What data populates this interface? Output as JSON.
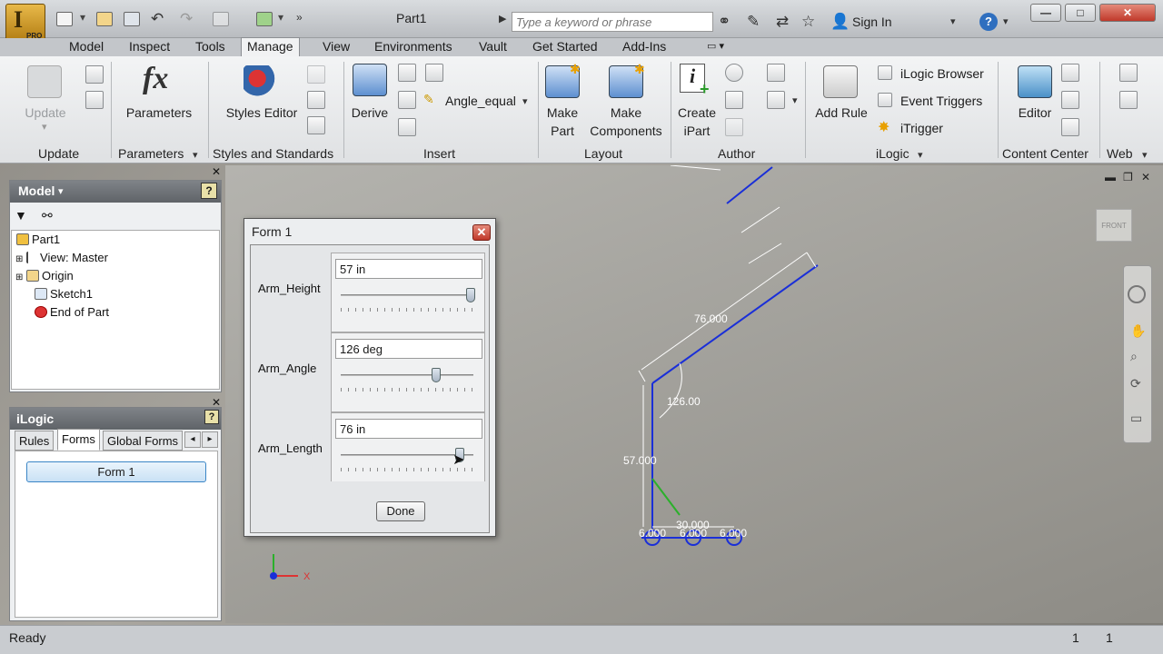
{
  "app": {
    "document_title": "Part1",
    "logo_sub": "PRO"
  },
  "search": {
    "placeholder": "Type a keyword or phrase"
  },
  "signin": {
    "label": "Sign In"
  },
  "help": {
    "label": "?"
  },
  "window": {
    "minimize": "—",
    "restore": "□",
    "close": "✕"
  },
  "ribbon_tabs": [
    "Model",
    "Inspect",
    "Tools",
    "Manage",
    "View",
    "Environments",
    "Vault",
    "Get Started",
    "Add-Ins"
  ],
  "active_tab": "Manage",
  "ribbon": {
    "update": {
      "label": "Update",
      "panel": "Update"
    },
    "parameters": {
      "label": "Parameters",
      "panel": "Parameters"
    },
    "styles_editor": {
      "label": "Styles Editor",
      "panel": "Styles and Standards"
    },
    "derive": {
      "label": "Derive"
    },
    "angle_dropdown": {
      "value": "Angle_equal"
    },
    "insert_panel": "Insert",
    "make_part": {
      "line1": "Make",
      "line2": "Part"
    },
    "make_components": {
      "line1": "Make",
      "line2": "Components"
    },
    "layout_panel": "Layout",
    "create_ipart": {
      "line1": "Create",
      "line2": "iPart"
    },
    "author_panel": "Author",
    "add_rule": {
      "label": "Add Rule"
    },
    "ilogic_browser": {
      "label": "iLogic Browser"
    },
    "event_triggers": {
      "label": "Event Triggers"
    },
    "itrigger": {
      "label": "iTrigger"
    },
    "ilogic_panel": "iLogic",
    "editor": {
      "label": "Editor"
    },
    "content_center_panel": "Content Center",
    "web_panel": "Web"
  },
  "model_browser": {
    "title": "Model",
    "items": [
      "Part1",
      "View: Master",
      "Origin",
      "Sketch1",
      "End of Part"
    ]
  },
  "ilogic_pane": {
    "title": "iLogic",
    "tabs": [
      "Rules",
      "Forms",
      "Global Forms"
    ],
    "active_tab": "Forms",
    "form_button": "Form 1"
  },
  "form1": {
    "title": "Form 1",
    "params": [
      {
        "name": "Arm_Height",
        "value": "57 in",
        "slider_fraction": 0.98
      },
      {
        "name": "Arm_Angle",
        "value": "126 deg",
        "slider_fraction": 0.72
      },
      {
        "name": "Arm_Length",
        "value": "76 in",
        "slider_fraction": 0.9
      }
    ],
    "done": "Done"
  },
  "sketch": {
    "dim_length": "76.000",
    "dim_angle": "126.00",
    "dim_height": "57.000",
    "dim_base": "30.000",
    "dim_w1": "6.000",
    "dim_w2": "6.000",
    "dim_w3": "6.000"
  },
  "viewcube": {
    "label": "FRONT"
  },
  "axis": {
    "x": "X"
  },
  "status": {
    "text": "Ready",
    "n1": "1",
    "n2": "1"
  }
}
